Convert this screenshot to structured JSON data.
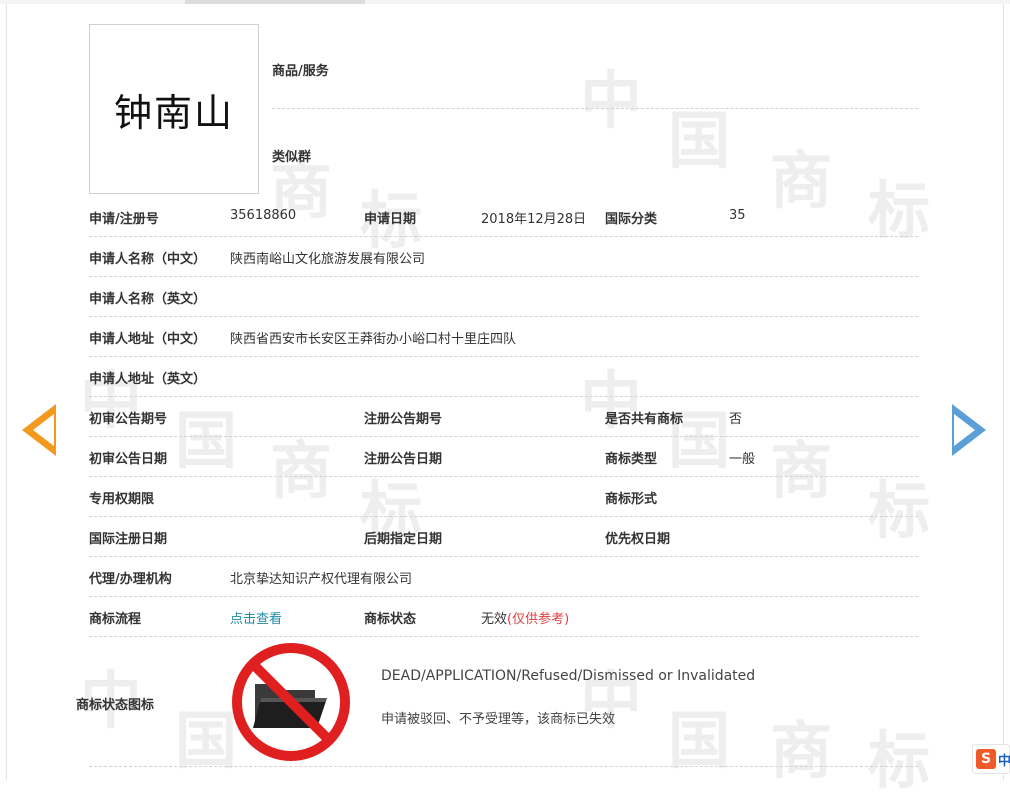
{
  "trademark": {
    "name": "钟南山"
  },
  "goods_label": "商品/服务",
  "similar_group_label": "类似群",
  "fields": {
    "reg_no_label": "申请/注册号",
    "reg_no": "35618860",
    "app_date_label": "申请日期",
    "app_date": "2018年12月28日",
    "intl_class_label": "国际分类",
    "intl_class": "35",
    "applicant_cn_label": "申请人名称（中文）",
    "applicant_cn": "陕西南峪山文化旅游发展有限公司",
    "applicant_en_label": "申请人名称（英文）",
    "address_cn_label": "申请人地址（中文）",
    "address_cn": "陕西省西安市长安区王莽街办小峪口村十里庄四队",
    "address_en_label": "申请人地址（英文）",
    "prelim_pub_no_label": "初审公告期号",
    "reg_pub_no_label": "注册公告期号",
    "shared_label": "是否共有商标",
    "shared": "否",
    "prelim_pub_date_label": "初审公告日期",
    "reg_pub_date_label": "注册公告日期",
    "tm_type_label": "商标类型",
    "tm_type": "一般",
    "exclusive_period_label": "专用权期限",
    "tm_form_label": "商标形式",
    "intl_reg_date_label": "国际注册日期",
    "later_designation_label": "后期指定日期",
    "priority_date_label": "优先权日期",
    "agent_label": "代理/办理机构",
    "agent": "北京挚达知识产权代理有限公司",
    "process_label": "商标流程",
    "process_link": "点击查看",
    "status_label": "商标状态",
    "status_value": "无效",
    "status_note": "(仅供参考)"
  },
  "status_icon": {
    "label": "商标状态图标",
    "icon": "folder-prohibited-icon",
    "en": "DEAD/APPLICATION/Refused/Dismissed or Invalidated",
    "cn": "申请被驳回、不予受理等，该商标已失效"
  },
  "nav": {
    "prev_icon": "arrow-left-icon",
    "next_icon": "arrow-right-icon"
  },
  "ime": {
    "logo": "S",
    "char": "中"
  },
  "colors": {
    "link": "#1f8ca8",
    "reference_note": "#e04040",
    "prev_arrow": "#f39a1e",
    "next_arrow": "#5b9fd8",
    "prohibited": "#e02020"
  }
}
